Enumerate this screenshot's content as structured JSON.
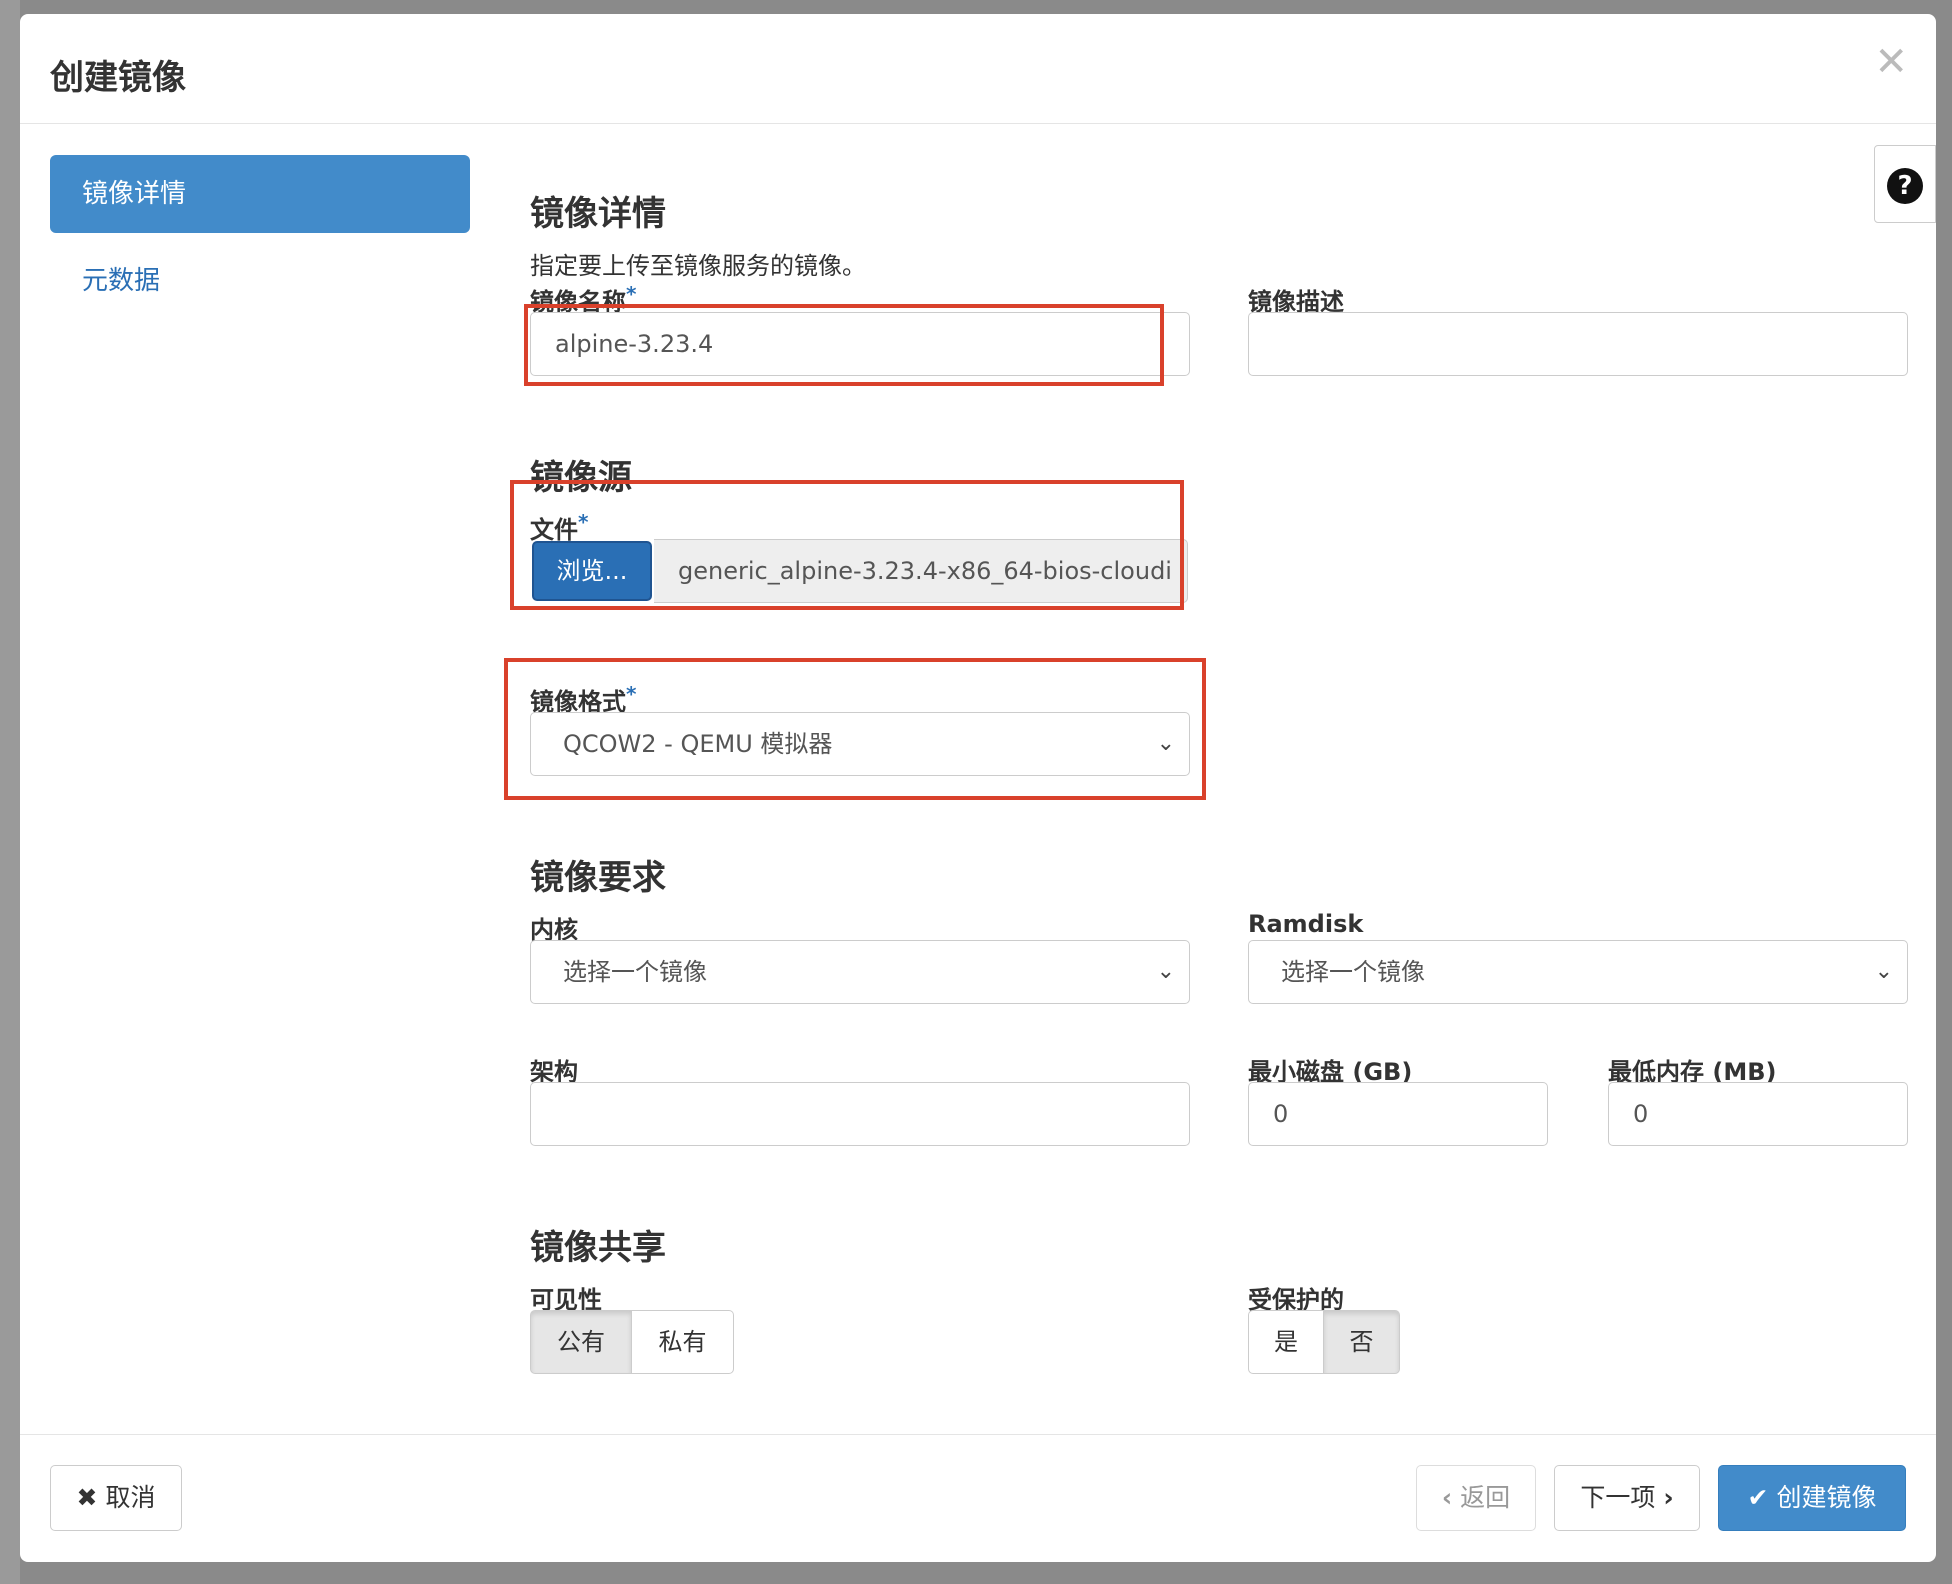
{
  "modal": {
    "title": "创建镜像",
    "close_icon": "close-icon"
  },
  "nav": {
    "items": [
      {
        "label": "镜像详情",
        "active": true
      },
      {
        "label": "元数据",
        "active": false
      }
    ]
  },
  "help": {
    "glyph": "?"
  },
  "details": {
    "heading": "镜像详情",
    "description": "指定要上传至镜像服务的镜像。",
    "name_label": "镜像名称",
    "name_value": "alpine-3.23.4",
    "required_mark": "*",
    "desc_label": "镜像描述",
    "desc_value": ""
  },
  "source": {
    "heading": "镜像源",
    "file_label": "文件",
    "browse_label": "浏览...",
    "file_name": "generic_alpine-3.23.4-x86_64-bios-cloudi"
  },
  "format": {
    "label": "镜像格式",
    "selected": "QCOW2 - QEMU 模拟器"
  },
  "requirements": {
    "heading": "镜像要求",
    "kernel_label": "内核",
    "kernel_selected": "选择一个镜像",
    "ramdisk_label": "Ramdisk",
    "ramdisk_selected": "选择一个镜像",
    "arch_label": "架构",
    "arch_value": "",
    "min_disk_label": "最小磁盘 (GB)",
    "min_disk_value": "0",
    "min_ram_label": "最低内存 (MB)",
    "min_ram_value": "0"
  },
  "sharing": {
    "heading": "镜像共享",
    "visibility_label": "可见性",
    "visibility_options": [
      "公有",
      "私有"
    ],
    "visibility_selected": "公有",
    "protected_label": "受保护的",
    "protected_options": [
      "是",
      "否"
    ],
    "protected_selected": "否"
  },
  "footer": {
    "cancel_label": "取消",
    "cancel_icon": "✖",
    "back_label": "返回",
    "back_icon": "‹",
    "next_label": "下一项",
    "next_icon": "›",
    "create_label": "创建镜像",
    "create_icon": "✔"
  },
  "colors": {
    "primary": "#428bca",
    "highlight": "#d9412b"
  }
}
